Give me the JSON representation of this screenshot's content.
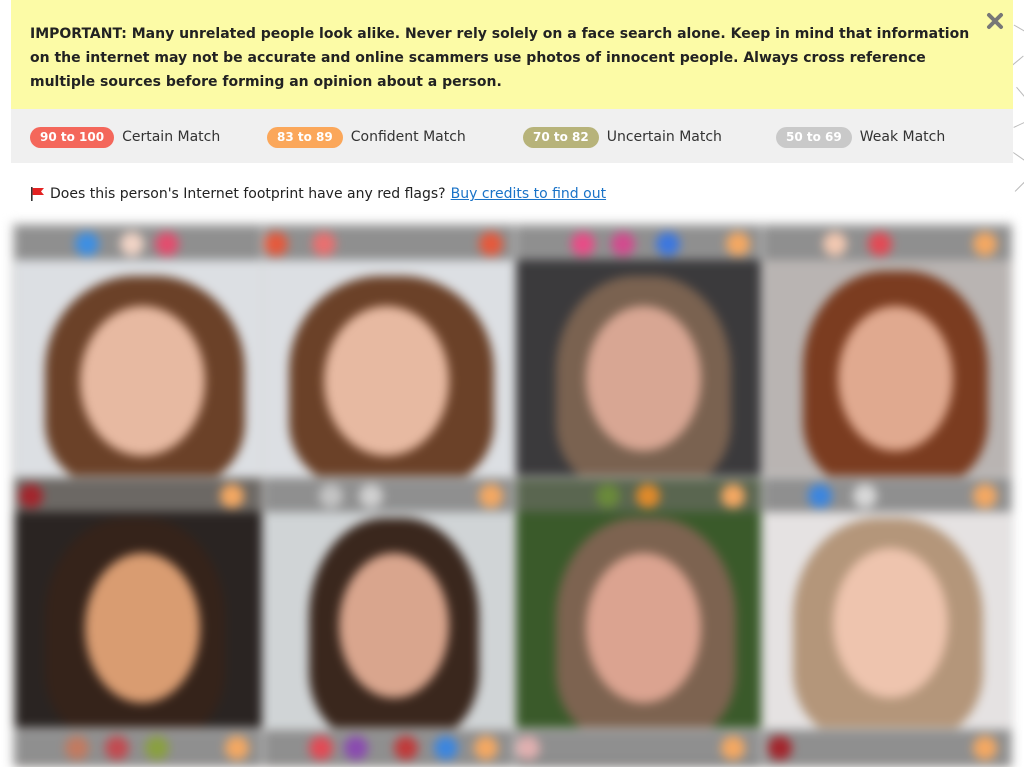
{
  "notice": {
    "text": "IMPORTANT: Many unrelated people look alike. Never rely solely on a face search alone. Keep in mind that information on the internet may not be accurate and online scammers use photos of innocent people. Always cross reference multiple sources before forming an opinion about a person.",
    "close_icon": "close-icon"
  },
  "legend": [
    {
      "range": "90 to 100",
      "label": "Certain Match",
      "color": "#f4675b"
    },
    {
      "range": "83 to 89",
      "label": "Confident Match",
      "color": "#fba75a"
    },
    {
      "range": "70 to 82",
      "label": "Uncertain Match",
      "color": "#b7b37a"
    },
    {
      "range": "50 to 69",
      "label": "Weak Match",
      "color": "#c9c9c9"
    }
  ],
  "flags": {
    "question": "Does this person's Internet footprint have any red flags?",
    "link": "Buy credits to find out",
    "icon": "red-flag-icon"
  },
  "results": {
    "tiles": 12
  }
}
